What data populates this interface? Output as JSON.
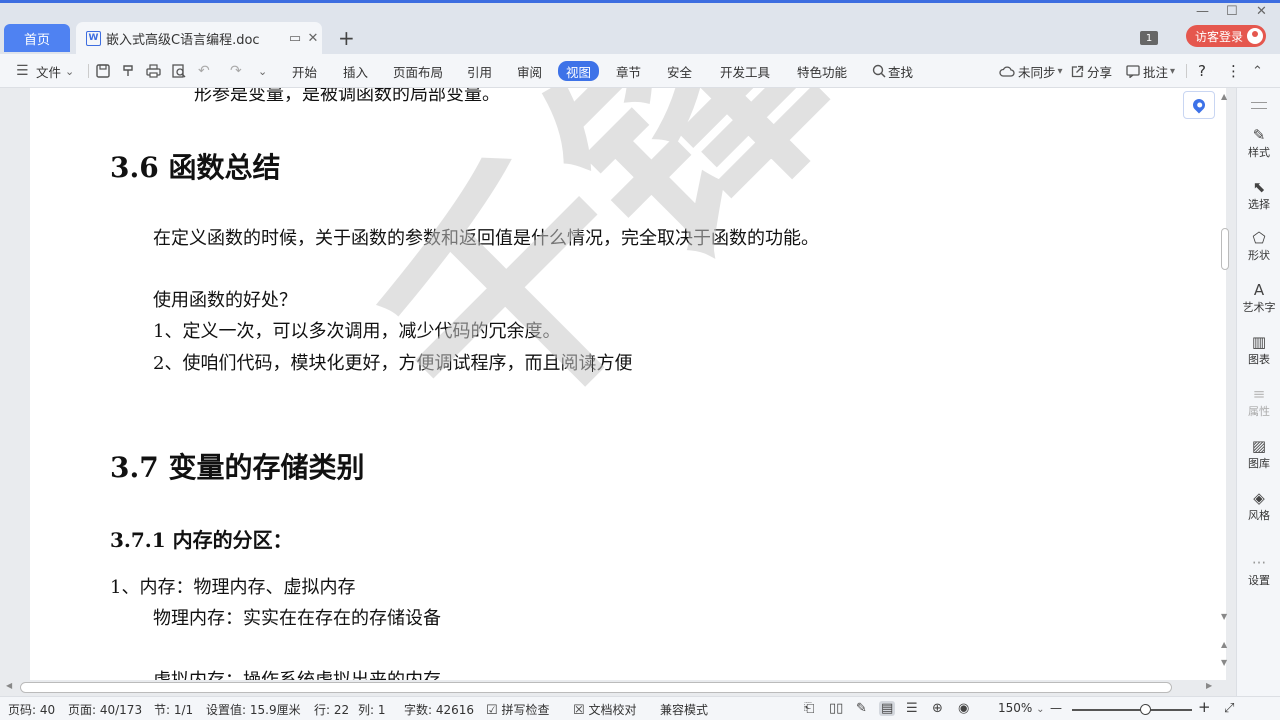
{
  "tabs": {
    "home_label": "首页",
    "doc_icon": "W",
    "doc_title": "嵌入式高级C语言编程.doc",
    "restore_glyph": "▭",
    "close_glyph": "✕",
    "new_tab_glyph": "+"
  },
  "window": {
    "minimize_glyph": "—",
    "maximize_glyph": "☐",
    "close_glyph": "✕",
    "badge": "1",
    "guest_label": "访客登录"
  },
  "ribbon": {
    "menu_glyph": "☰",
    "file_label": "文件",
    "file_arrow": "⌄",
    "save_glyph": "🖫",
    "undo_glyph": "↶",
    "redo_glyph": "↷",
    "more_glyph": "⌄",
    "tabs": [
      "开始",
      "插入",
      "页面布局",
      "引用",
      "审阅",
      "视图",
      "章节",
      "安全",
      "开发工具",
      "特色功能"
    ],
    "search_label": "查找",
    "sync_label": "未同步",
    "share_label": "分享",
    "comment_label": "批注",
    "help_glyph": "?",
    "more_v_glyph": "⋮",
    "collapse_glyph": "⌃"
  },
  "document": {
    "partial_top_line": "形参是变量，是被调函数的局部变量。",
    "h_3_6": "3.6  函数总结",
    "p1": "在定义函数的时候，关于函数的参数和返回值是什么情况，完全取决于函数的功能。",
    "p2": "使用函数的好处？",
    "p3": "1、定义一次，可以多次调用，减少代码的冗余度。",
    "p4": "2、使咱们代码，模块化更好，方便调试程序，而且阅读方便",
    "h_3_7": "3.7  变量的存储类别",
    "h_3_7_1": "3.7.1  内存的分区：",
    "p5": "1、内存：物理内存、虚拟内存",
    "p6": "物理内存：实实在在存在的存储设备",
    "partial_bottom_line": "虚拟内存：操作系统虚拟出来的内存"
  },
  "watermark": "千锋教育",
  "side_panel": [
    {
      "icon": "style-icon",
      "glyph": "✎",
      "label": "样式",
      "enabled": true
    },
    {
      "icon": "select-icon",
      "glyph": "⬉",
      "label": "选择",
      "enabled": true
    },
    {
      "icon": "shape-icon",
      "glyph": "⬠",
      "label": "形状",
      "enabled": true
    },
    {
      "icon": "wordart-icon",
      "glyph": "A",
      "label": "艺术字",
      "enabled": true
    },
    {
      "icon": "chart-icon",
      "glyph": "▥",
      "label": "图表",
      "enabled": true
    },
    {
      "icon": "property-icon",
      "glyph": "≡",
      "label": "属性",
      "enabled": false
    },
    {
      "icon": "gallery-icon",
      "glyph": "▨",
      "label": "图库",
      "enabled": true
    },
    {
      "icon": "theme-icon",
      "glyph": "◈",
      "label": "风格",
      "enabled": true
    },
    {
      "icon": "settings-icon",
      "glyph": "···",
      "label": "设置",
      "enabled": true
    }
  ],
  "status": {
    "page_code": "页码: 40",
    "page": "页面: 40/173",
    "section": "节: 1/1",
    "set_value": "设置值: 15.9厘米",
    "row": "行: 22",
    "col": "列: 1",
    "word_count": "字数: 42616",
    "spell_check": "拼写检查",
    "doc_proof": "文档校对",
    "compat_mode": "兼容模式",
    "zoom": "150%",
    "zoom_out_glyph": "—",
    "zoom_in_glyph": "+",
    "zoom_level": 0.62,
    "fullscreen_glyph": "⤢"
  }
}
